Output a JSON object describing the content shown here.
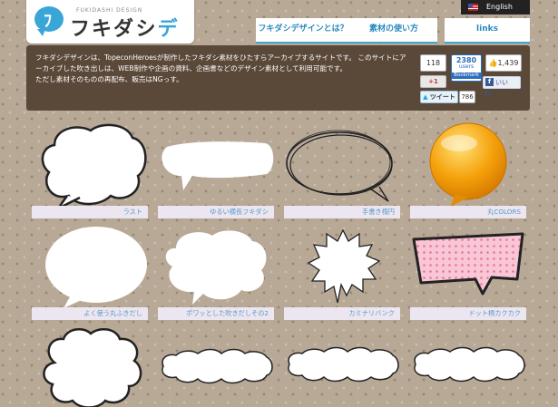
{
  "logo": {
    "sub": "FUKIDASHI DESIGN",
    "main_pre": "フキダシ",
    "main_post": "デザイン",
    "mark": "ﾌ"
  },
  "lang": {
    "label": "English"
  },
  "nav": [
    {
      "label": "フキダシデザインとは？"
    },
    {
      "label": "素材の使い方"
    },
    {
      "label": "links"
    }
  ],
  "intro": {
    "line1": "フキダシデザインは、TopeconHeroesが制作したフキダシ素材をひたすらアーカイブするサイトです。 このサイトにア",
    "line2": "ーカイブした吹き出しは、WEB制作や企画の資料、企画書などのデザイン素材として利用可能です。",
    "line3": "ただし素材そのものの再配布、販売はNGっす。"
  },
  "social": {
    "count": "118",
    "gplus": "+1",
    "hatena_num": "2380",
    "hatena_users": "users",
    "hatena_label": "Bookmark",
    "fb_count": "1,439",
    "fb_label": "いいね！",
    "tw_label": "ツイート",
    "tw_count": "786"
  },
  "items": [
    {
      "label": "ラスト"
    },
    {
      "label": "ゆるい横長フキダシ"
    },
    {
      "label": "手書き楕円"
    },
    {
      "label": "丸COLORS"
    },
    {
      "label": "よく使う丸ふきだし"
    },
    {
      "label": "ポワッとした吹きだしその2"
    },
    {
      "label": "カミナリバンク"
    },
    {
      "label": "ドット柄カクカク"
    }
  ],
  "colors": {
    "accent": "#3aa6d8",
    "intro_bg": "#5a4839",
    "orange": "#f5a20c",
    "pink": "#f6b7cc"
  }
}
